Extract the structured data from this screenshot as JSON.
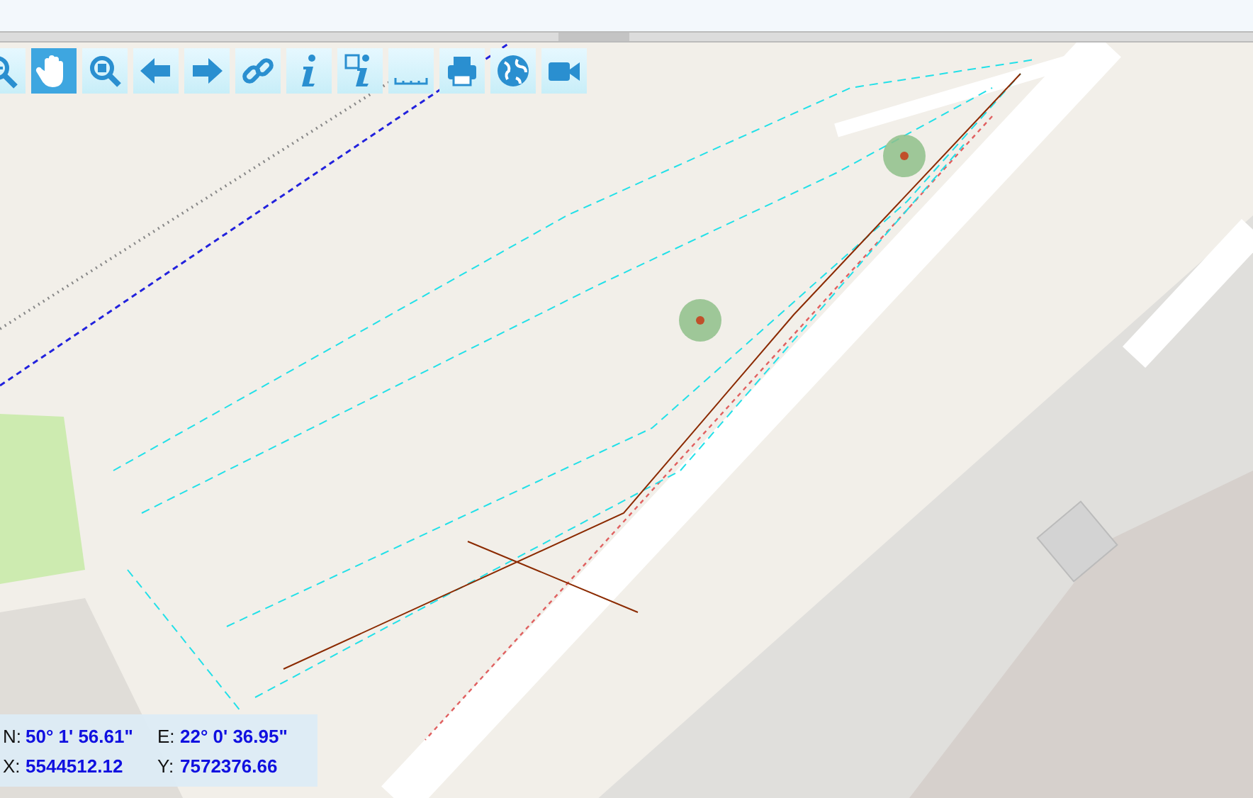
{
  "toolbar": {
    "tools": [
      {
        "kind": "zoom-out",
        "selected": false
      },
      {
        "kind": "pan",
        "selected": true
      },
      {
        "kind": "zoom-box",
        "selected": false
      },
      {
        "kind": "back",
        "selected": false
      },
      {
        "kind": "forward",
        "selected": false
      },
      {
        "kind": "link",
        "selected": false
      },
      {
        "kind": "info",
        "selected": false
      },
      {
        "kind": "info-area",
        "selected": false
      },
      {
        "kind": "measure",
        "selected": false
      },
      {
        "kind": "print",
        "selected": false
      },
      {
        "kind": "globe",
        "selected": false
      },
      {
        "kind": "video",
        "selected": false
      }
    ]
  },
  "map": {
    "markers": [
      {
        "kind": "point"
      },
      {
        "kind": "point"
      }
    ]
  },
  "coordinates": {
    "rows": [
      {
        "label_1": "N:",
        "value_1": "50° 1' 56.61\"",
        "label_2": "E:",
        "value_2": "22° 0' 36.95\""
      },
      {
        "label_1": "X:",
        "value_1": "5544512.12",
        "label_2": "Y:",
        "value_2": "7572376.66"
      }
    ]
  }
}
